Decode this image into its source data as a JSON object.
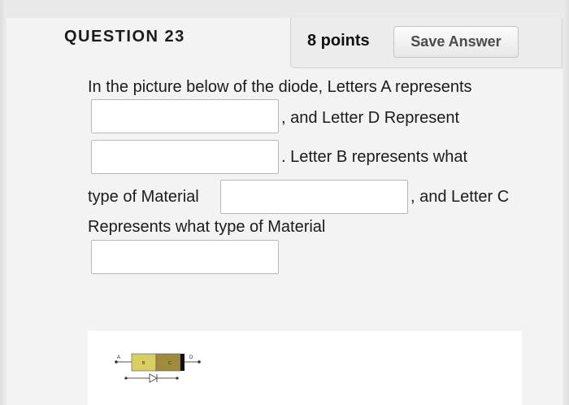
{
  "question": {
    "title": "QUESTION 23",
    "points": "8 points",
    "save_label": "Save Answer"
  },
  "prompt": {
    "line1": "In the picture below of the diode, Letters A represents",
    "after_blank1": ", and Letter D Represent",
    "after_blank2": ". Letter B represents what",
    "before_blank3": "type of Material",
    "after_blank3": ", and Letter C",
    "line_last": "Represents what type of Material"
  },
  "answers": {
    "blank1": "",
    "blank2": "",
    "blank3": "",
    "blank4": ""
  },
  "diagram": {
    "label_a": "A",
    "label_b": "B",
    "label_c": "C",
    "label_d": "D",
    "color_b": "#d8cf63",
    "color_c": "#a08b3d",
    "color_band": "#111111"
  }
}
